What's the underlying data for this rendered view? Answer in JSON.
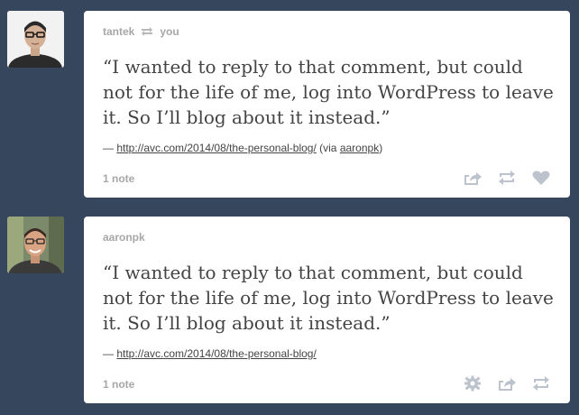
{
  "posts": [
    {
      "author": "tantek",
      "reblogged_to": "you",
      "quote": "“I wanted to reply to that comment, but could not for the life of me, log into WordPress to leave it. So I’ll blog about it instead.”",
      "source_prefix": "— ",
      "source_link": "http://avc.com/2014/08/the-personal-blog/",
      "via_prefix": " (via ",
      "via_link": "aaronpk",
      "via_suffix": ")",
      "notes": "1 note",
      "actions": [
        "share-icon",
        "reblog-icon",
        "like-icon"
      ]
    },
    {
      "author": "aaronpk",
      "quote": "“I wanted to reply to that comment, but could not for the life of me, log into WordPress to leave it. So I’ll blog about it instead.”",
      "source_prefix": "— ",
      "source_link": "http://avc.com/2014/08/the-personal-blog/",
      "notes": "1 note",
      "actions": [
        "gear-icon",
        "share-icon",
        "reblog-icon"
      ]
    }
  ],
  "colors": {
    "background": "#36465d",
    "card": "#ffffff",
    "muted": "#a7a7a7",
    "text": "#444444",
    "icon": "#bcc3cc"
  }
}
